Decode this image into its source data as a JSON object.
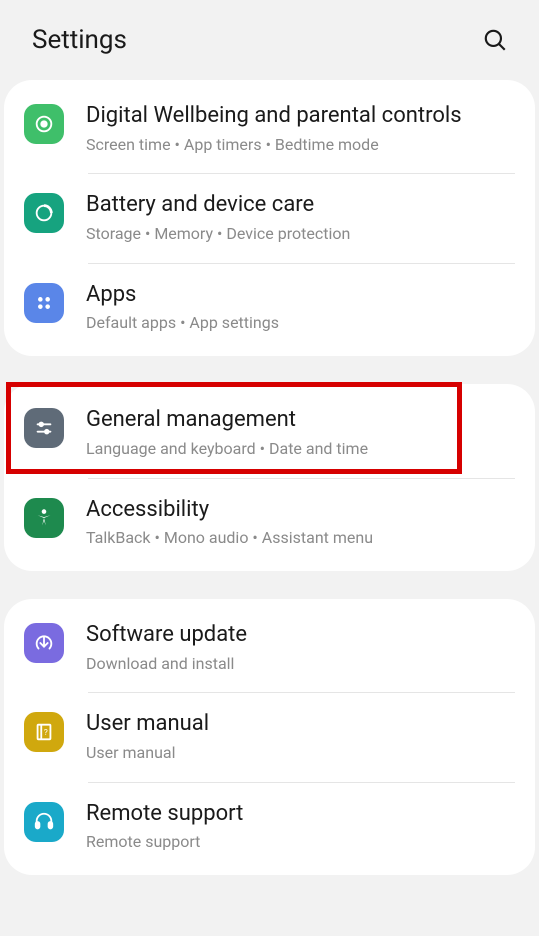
{
  "header": {
    "title": "Settings"
  },
  "groups": [
    {
      "items": [
        {
          "key": "digital-wellbeing",
          "title": "Digital Wellbeing and parental controls",
          "subtitle": "Screen time  •  App timers  •  Bedtime mode",
          "icon": "wellbeing-icon",
          "bg": "#3fbf6a"
        },
        {
          "key": "battery-device-care",
          "title": "Battery and device care",
          "subtitle": "Storage  •  Memory  •  Device protection",
          "icon": "device-care-icon",
          "bg": "#16a37f"
        },
        {
          "key": "apps",
          "title": "Apps",
          "subtitle": "Default apps  •  App settings",
          "icon": "apps-icon",
          "bg": "#5a86e8"
        }
      ]
    },
    {
      "items": [
        {
          "key": "general-management",
          "title": "General management",
          "subtitle": "Language and keyboard  •  Date and time",
          "icon": "general-icon",
          "bg": "#5f6b78",
          "highlighted": true
        },
        {
          "key": "accessibility",
          "title": "Accessibility",
          "subtitle": "TalkBack  •  Mono audio  •  Assistant menu",
          "icon": "accessibility-icon",
          "bg": "#1e8a4e"
        }
      ]
    },
    {
      "items": [
        {
          "key": "software-update",
          "title": "Software update",
          "subtitle": "Download and install",
          "icon": "update-icon",
          "bg": "#7a6be0"
        },
        {
          "key": "user-manual",
          "title": "User manual",
          "subtitle": "User manual",
          "icon": "manual-icon",
          "bg": "#d0a80e"
        },
        {
          "key": "remote-support",
          "title": "Remote support",
          "subtitle": "Remote support",
          "icon": "support-icon",
          "bg": "#1aa9c9"
        }
      ]
    }
  ]
}
